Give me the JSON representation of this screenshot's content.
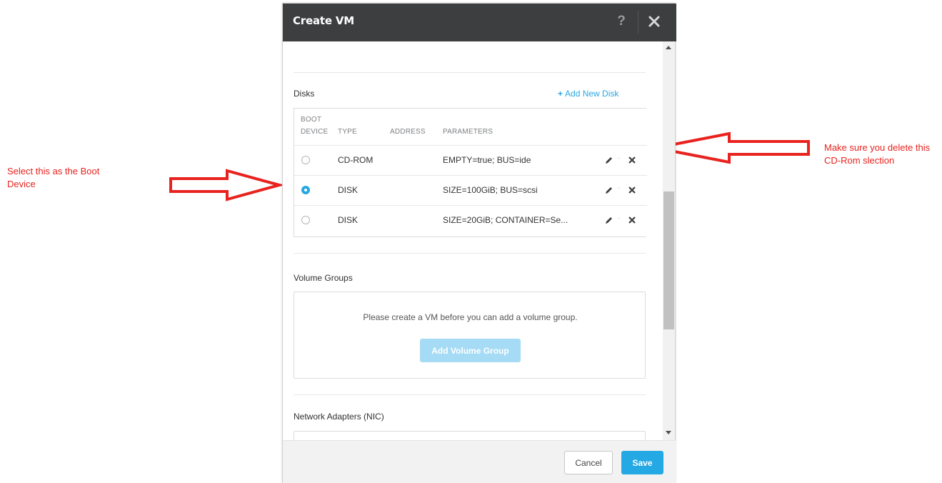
{
  "annotations": {
    "left_note": "Select  this as the Boot Device",
    "right_note": "Make sure you delete this CD-Rom slection",
    "arrow_color": "#e8231f"
  },
  "modal": {
    "title": "Create VM",
    "help_label": "?",
    "header_color": "#3d3e40",
    "accent_color": "#26a7e0"
  },
  "disks": {
    "section_title": "Disks",
    "add_label": "Add New Disk",
    "add_icon": "plus-icon",
    "columns": {
      "boot_device_line1": "BOOT",
      "boot_device_line2": "DEVICE",
      "type": "TYPE",
      "address": "ADDRESS",
      "parameters": "PARAMETERS"
    },
    "rows": [
      {
        "boot_selected": false,
        "type": "CD-ROM",
        "address": "",
        "parameters": "EMPTY=true; BUS=ide"
      },
      {
        "boot_selected": true,
        "type": "DISK",
        "address": "",
        "parameters": "SIZE=100GiB; BUS=scsi"
      },
      {
        "boot_selected": false,
        "type": "DISK",
        "address": "",
        "parameters": "SIZE=20GiB; CONTAINER=Se..."
      }
    ],
    "row_separator": "·"
  },
  "volume_groups": {
    "section_title": "Volume Groups",
    "message": "Please create a VM before you can add a volume group.",
    "add_button": "Add Volume Group"
  },
  "network": {
    "section_title": "Network Adapters (NIC)"
  },
  "footer": {
    "cancel_label": "Cancel",
    "save_label": "Save"
  }
}
